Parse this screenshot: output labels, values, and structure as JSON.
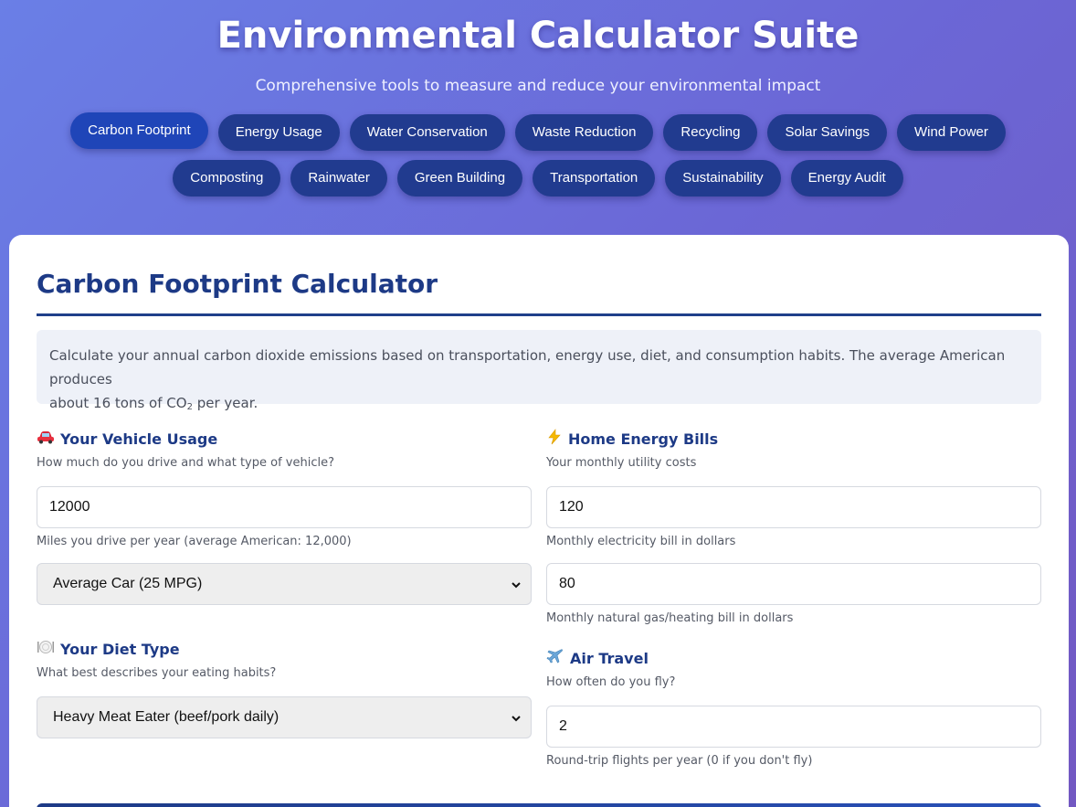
{
  "header": {
    "title": "Environmental Calculator Suite",
    "subtitle": "Comprehensive tools to measure and reduce your environmental impact"
  },
  "nav": {
    "row1": [
      "Carbon Footprint",
      "Energy Usage",
      "Water Conservation",
      "Waste Reduction",
      "Recycling",
      "Solar Savings",
      "Wind Power",
      "Composting"
    ],
    "row2": [
      "Rainwater",
      "Green Building",
      "Transportation",
      "Sustainability",
      "Energy Audit"
    ],
    "active": "Carbon Footprint"
  },
  "calculator": {
    "title": "Carbon Footprint Calculator",
    "info_line1": "Calculate your annual carbon dioxide emissions based on transportation, energy use, diet, and consumption habits. The average American produces",
    "info_line2_pre": "about 16 tons of CO",
    "info_line2_sub": "2",
    "info_line2_post": " per year.",
    "vehicle": {
      "icon": "car-icon",
      "title": "Your Vehicle Usage",
      "desc": "How much do you drive and what type of vehicle?",
      "miles_value": "12000",
      "miles_hint": "Miles you drive per year (average American: 12,000)",
      "vehicle_type": "Average Car (25 MPG)"
    },
    "energy": {
      "icon": "lightning-icon",
      "title": "Home Energy Bills",
      "desc": "Your monthly utility costs",
      "electricity_value": "120",
      "electricity_hint": "Monthly electricity bill in dollars",
      "gas_value": "80",
      "gas_hint": "Monthly natural gas/heating bill in dollars"
    },
    "diet": {
      "icon": "plate-icon",
      "title": "Your Diet Type",
      "desc": "What best describes your eating habits?",
      "diet_type": "Heavy Meat Eater (beef/pork daily)"
    },
    "air": {
      "icon": "airplane-icon",
      "title": "Air Travel",
      "desc": "How often do you fly?",
      "flights_value": "2",
      "flights_hint": "Round-trip flights per year (0 if you don't fly)"
    }
  },
  "colors": {
    "nav_button": "#213b8f",
    "nav_active": "#1f45b8",
    "heading": "#1d3a86",
    "info_bg": "#eef1f8"
  }
}
